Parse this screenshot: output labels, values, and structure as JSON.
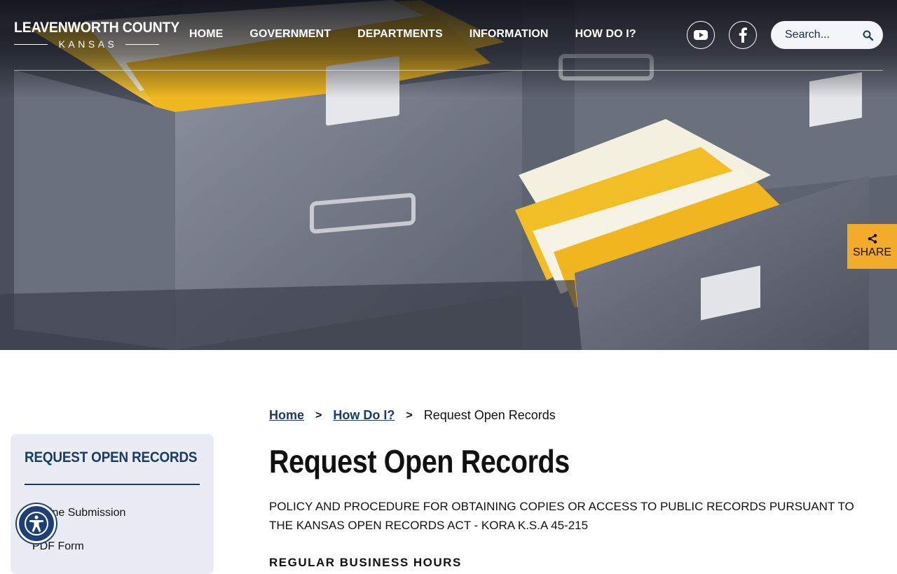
{
  "header": {
    "logo": {
      "title": "LEAVENWORTH COUNTY",
      "subtitle": "KANSAS"
    },
    "nav": [
      "HOME",
      "GOVERNMENT",
      "DEPARTMENTS",
      "INFORMATION",
      "HOW DO I?"
    ],
    "search": {
      "placeholder": "Search..."
    },
    "social": [
      "youtube-icon",
      "facebook-icon"
    ]
  },
  "share": {
    "label": "SHARE",
    "color": "#f2ab2a"
  },
  "sidebar": {
    "title": "REQUEST OPEN RECORDS",
    "items": [
      "Online Submission",
      "PDF Form"
    ]
  },
  "breadcrumb": {
    "home": "Home",
    "parent": "How Do I?",
    "separator": ">",
    "current": "Request Open Records"
  },
  "main": {
    "title": "Request Open Records",
    "policy": "POLICY AND PROCEDURE FOR OBTAINING COPIES OR ACCESS TO PUBLIC RECORDS PURSUANT TO THE KANSAS OPEN RECORDS ACT - KORA K.S.A 45-215",
    "section_heading": "REGULAR BUSINESS HOURS"
  },
  "colors": {
    "brand_navy": "#1b3a66",
    "accessibility_blue": "#1e3f76",
    "sidebar_bg": "#e9edf3"
  }
}
